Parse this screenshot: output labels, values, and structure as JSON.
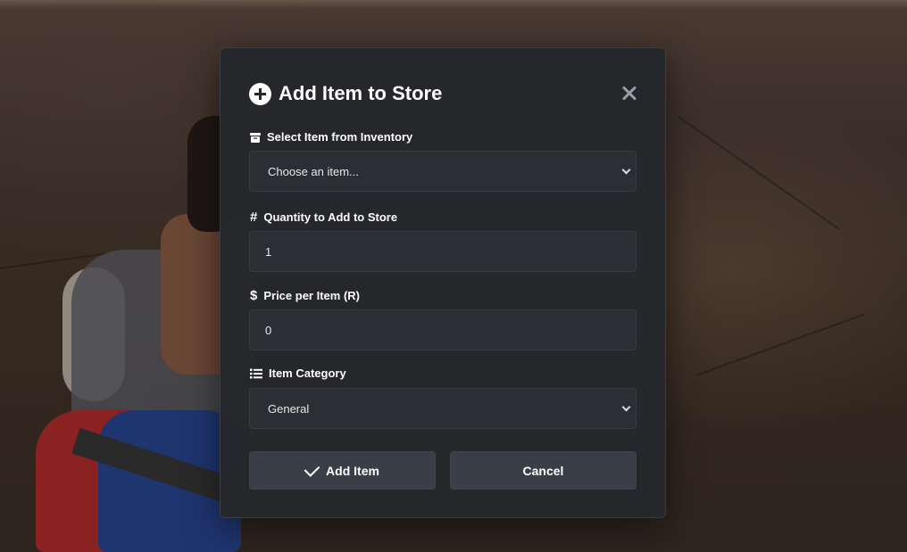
{
  "modal": {
    "title": "Add Item to Store",
    "title_icon": "plus-circle-icon",
    "close_icon": "close-icon"
  },
  "fields": {
    "item": {
      "label": "Select Item from Inventory",
      "icon": "box-icon",
      "selected": "Choose an item..."
    },
    "quantity": {
      "label": "Quantity to Add to Store",
      "icon": "hash-icon",
      "value": "1"
    },
    "price": {
      "label": "Price per Item (R)",
      "icon": "dollar-icon",
      "value": "0"
    },
    "category": {
      "label": "Item Category",
      "icon": "list-icon",
      "selected": "General"
    }
  },
  "buttons": {
    "add": "Add Item",
    "add_icon": "check-icon",
    "cancel": "Cancel"
  },
  "colors": {
    "modal_bg": "#25272b",
    "field_bg": "#2b2e33",
    "button_bg": "#3a3e46",
    "text": "#ffffff"
  }
}
